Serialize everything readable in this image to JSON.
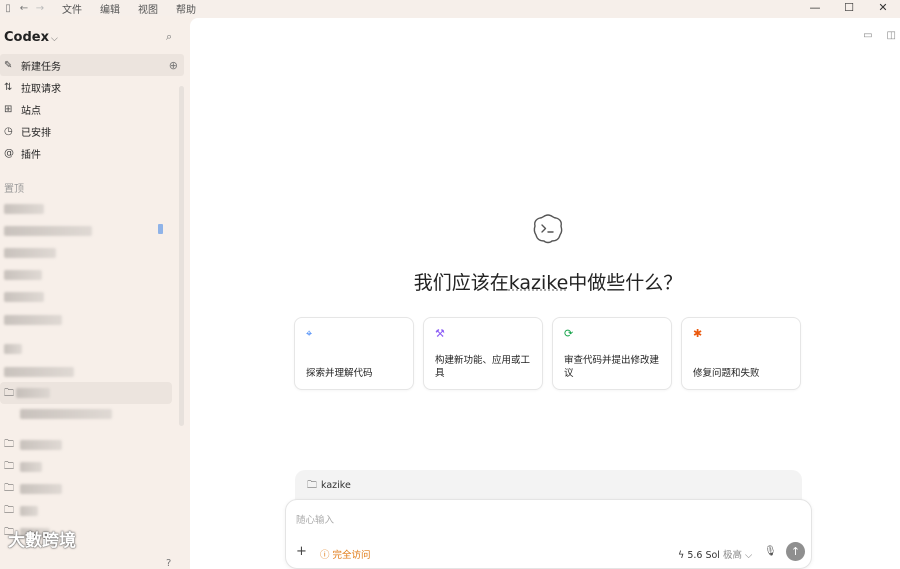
{
  "titlebar": {
    "menu": [
      "文件",
      "编辑",
      "视图",
      "帮助"
    ]
  },
  "sidebar": {
    "brand": "Codex",
    "nav": [
      {
        "label": "新建任务",
        "icon": "edit-icon"
      },
      {
        "label": "拉取请求",
        "icon": "pull-request-icon"
      },
      {
        "label": "站点",
        "icon": "sites-icon"
      },
      {
        "label": "已安排",
        "icon": "clock-icon"
      },
      {
        "label": "插件",
        "icon": "at-icon"
      }
    ],
    "section_pinned": "置顶"
  },
  "main": {
    "headline_pre": "我们应该在",
    "project": "kazike",
    "headline_post": "中做些什么？",
    "cards": [
      {
        "text": "探索并理解代码",
        "icon": "telescope-icon",
        "color": "#3b82f6"
      },
      {
        "text": "构建新功能、应用或工具",
        "icon": "hammer-icon",
        "color": "#8b5cf6"
      },
      {
        "text": "审查代码并提出修改建议",
        "icon": "refresh-icon",
        "color": "#16a34a"
      },
      {
        "text": "修复问题和失败",
        "icon": "bug-icon",
        "color": "#ea580c"
      }
    ],
    "project_bar": "kazike",
    "composer": {
      "placeholder": "随心输入",
      "access": "完全访问",
      "model": "5.6 Sol",
      "effort": "极高"
    }
  },
  "watermark": "大數跨境"
}
